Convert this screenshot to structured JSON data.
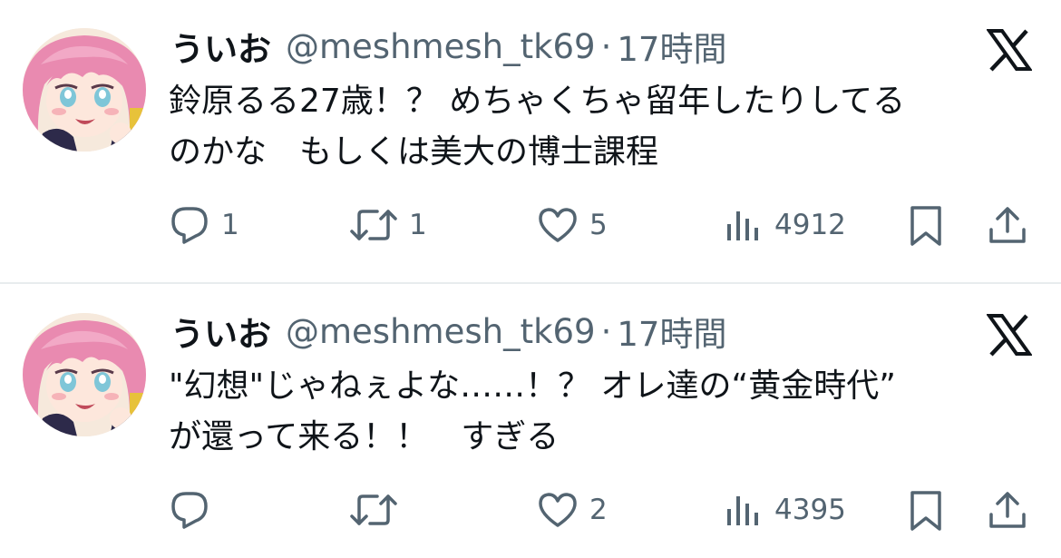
{
  "colors": {
    "text": "#0f1419",
    "secondary": "#536471",
    "divider": "#e8ecee",
    "background": "#ffffff"
  },
  "icons": [
    "avatar-image",
    "x-logo-icon",
    "reply-icon",
    "retweet-icon",
    "like-icon",
    "views-icon",
    "bookmark-icon",
    "share-icon"
  ],
  "tweets": [
    {
      "display_name": "ういお",
      "handle": "@meshmesh_tk69",
      "separator": "·",
      "time": "17時間",
      "text_lines": [
        "鈴原るる27歳！？ めちゃくちゃ留年したりしてる",
        "のかな　もしくは美大の博士課程"
      ],
      "replies": "1",
      "retweets": "1",
      "likes": "5",
      "views": "4912"
    },
    {
      "display_name": "ういお",
      "handle": "@meshmesh_tk69",
      "separator": "·",
      "time": "17時間",
      "text_lines": [
        "\"幻想\"じゃねぇよな……！？ オレ達の“黄金時代”",
        "が還って来る！！　すぎる"
      ],
      "replies": "",
      "retweets": "",
      "likes": "2",
      "views": "4395"
    }
  ]
}
